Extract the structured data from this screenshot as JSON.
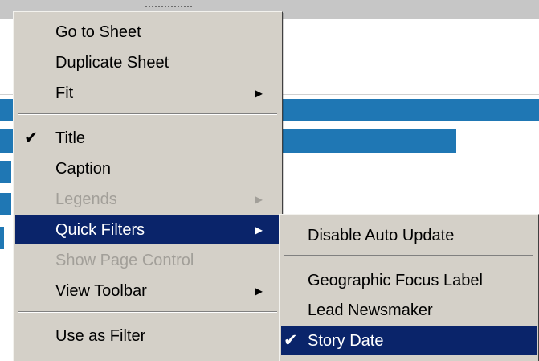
{
  "menu": {
    "items": [
      {
        "label": "Go to Sheet"
      },
      {
        "label": "Duplicate Sheet"
      },
      {
        "label": "Fit",
        "submenu": true
      },
      {
        "label": "Title",
        "checked": true
      },
      {
        "label": "Caption"
      },
      {
        "label": "Legends",
        "disabled": true,
        "submenu": true
      },
      {
        "label": "Quick Filters",
        "highlighted": true,
        "submenu": true
      },
      {
        "label": "Show Page Control",
        "disabled": true
      },
      {
        "label": "View Toolbar",
        "submenu": true
      },
      {
        "label": "Use as Filter"
      }
    ]
  },
  "submenu": {
    "items": [
      {
        "label": "Disable Auto Update"
      },
      {
        "label": "Geographic Focus Label"
      },
      {
        "label": "Lead Newsmaker"
      },
      {
        "label": "Story Date",
        "checked": true,
        "highlighted": true
      }
    ]
  },
  "icons": {
    "check": "check-icon",
    "submenu_arrow": "triangle-right-icon",
    "grip": "grip-dots-icon"
  },
  "colors": {
    "menu_background": "#d4d0c8",
    "highlight": "#0a246a",
    "disabled_text": "#a29f99",
    "bar_fill": "#1f77b4"
  }
}
